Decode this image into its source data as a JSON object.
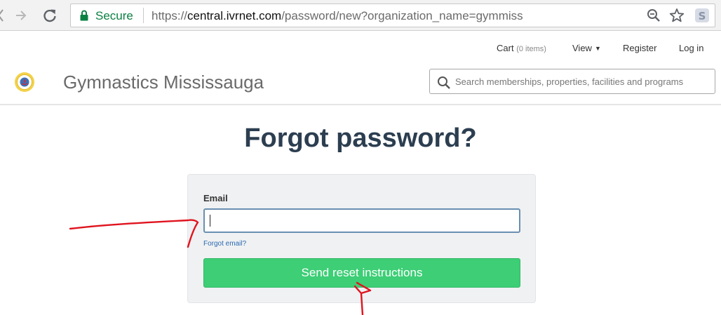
{
  "browser": {
    "secure_label": "Secure",
    "url_scheme": "https://",
    "url_host": "central.ivrnet.com",
    "url_path": "/password/new?organization_name=gymmiss"
  },
  "top_nav": {
    "cart_label": "Cart",
    "cart_count": "(0 items)",
    "view_label": "View",
    "register_label": "Register",
    "login_label": "Log in"
  },
  "header": {
    "site_name": "Gymnastics Mississauga",
    "search_placeholder": "Search memberships, properties, facilities and programs"
  },
  "main": {
    "title": "Forgot password?",
    "email_label": "Email",
    "email_value": "",
    "forgot_email_label": "Forgot email?",
    "submit_label": "Send reset instructions"
  },
  "colors": {
    "secure_green": "#0b8043",
    "title": "#2c3e50",
    "button_green": "#3dce76",
    "input_border": "#6a8fb0",
    "link_blue": "#2a6ab0",
    "annotation_red": "#e0141e"
  },
  "icons": [
    "forward-icon",
    "reload-icon",
    "lock-icon",
    "zoom-icon",
    "star-icon",
    "extension-icon",
    "logo-icon",
    "search-icon",
    "chevron-down-icon"
  ]
}
